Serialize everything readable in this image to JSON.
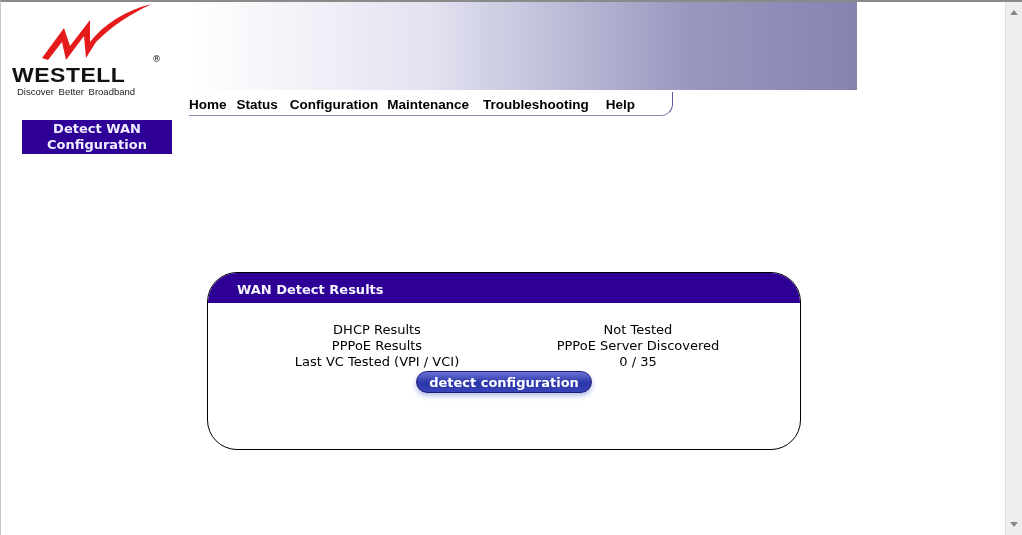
{
  "logo": {
    "brand": "WESTELL",
    "registered": "®",
    "tagline": "Discover Better Broadband"
  },
  "nav": [
    {
      "label": "Home"
    },
    {
      "label": "Status"
    },
    {
      "label": "Configuration"
    },
    {
      "label": "Maintenance"
    },
    {
      "label": "Troubleshooting"
    },
    {
      "label": "Help"
    }
  ],
  "sidebar": {
    "items": [
      {
        "label": "Detect WAN Configuration",
        "selected": true
      }
    ]
  },
  "panel": {
    "title": "WAN Detect Results",
    "rows": [
      {
        "label": "DHCP Results",
        "value": "Not Tested"
      },
      {
        "label": "PPPoE Results",
        "value": "PPPoE Server Discovered"
      },
      {
        "label": "Last VC Tested (VPI / VCI)",
        "value": "0 / 35"
      }
    ],
    "button": "detect configuration"
  }
}
